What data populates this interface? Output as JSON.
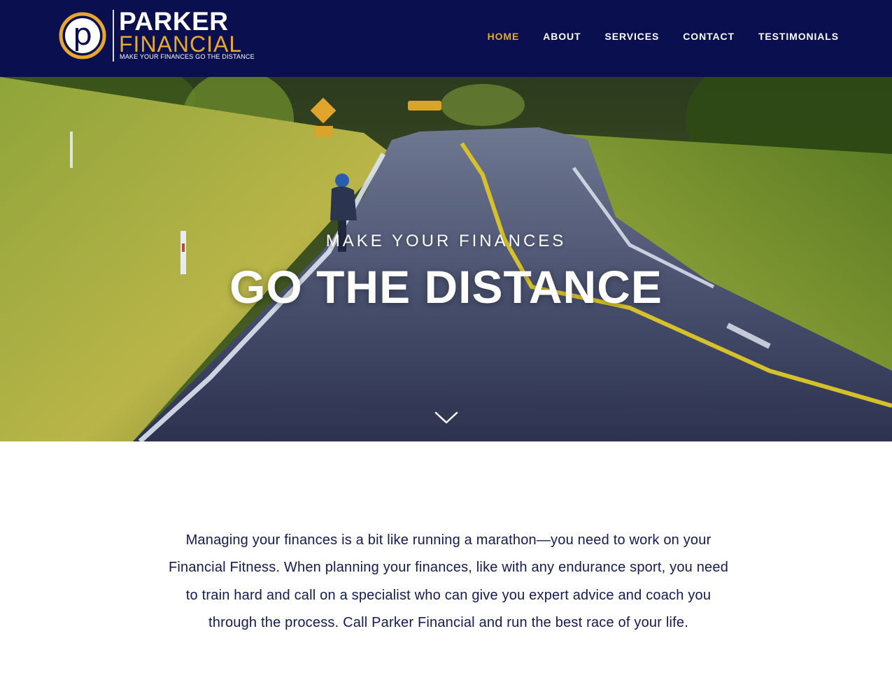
{
  "brand": {
    "logo_letter": "p",
    "name": "PARKER",
    "subname": "FINANCIAL",
    "tagline": "MAKE YOUR FINANCES GO THE DISTANCE"
  },
  "nav": {
    "items": [
      {
        "label": "HOME",
        "active": true
      },
      {
        "label": "ABOUT",
        "active": false
      },
      {
        "label": "SERVICES",
        "active": false
      },
      {
        "label": "CONTACT",
        "active": false
      },
      {
        "label": "TESTIMONIALS",
        "active": false
      }
    ]
  },
  "hero": {
    "kicker": "MAKE YOUR FINANCES",
    "title": "GO THE DISTANCE",
    "scroll_icon": "chevron-down-icon"
  },
  "intro": {
    "text": "Managing your finances is a bit like running a marathon—you need to work on your Financial Fitness. When planning your finances, like with any endurance sport, you need to train hard and call on a specialist who can give you expert advice and coach you through the process. Call Parker Financial and run the best race of your life."
  },
  "colors": {
    "header_bg": "#0a0f4f",
    "accent": "#e8a92a",
    "body_text": "#141a55"
  }
}
